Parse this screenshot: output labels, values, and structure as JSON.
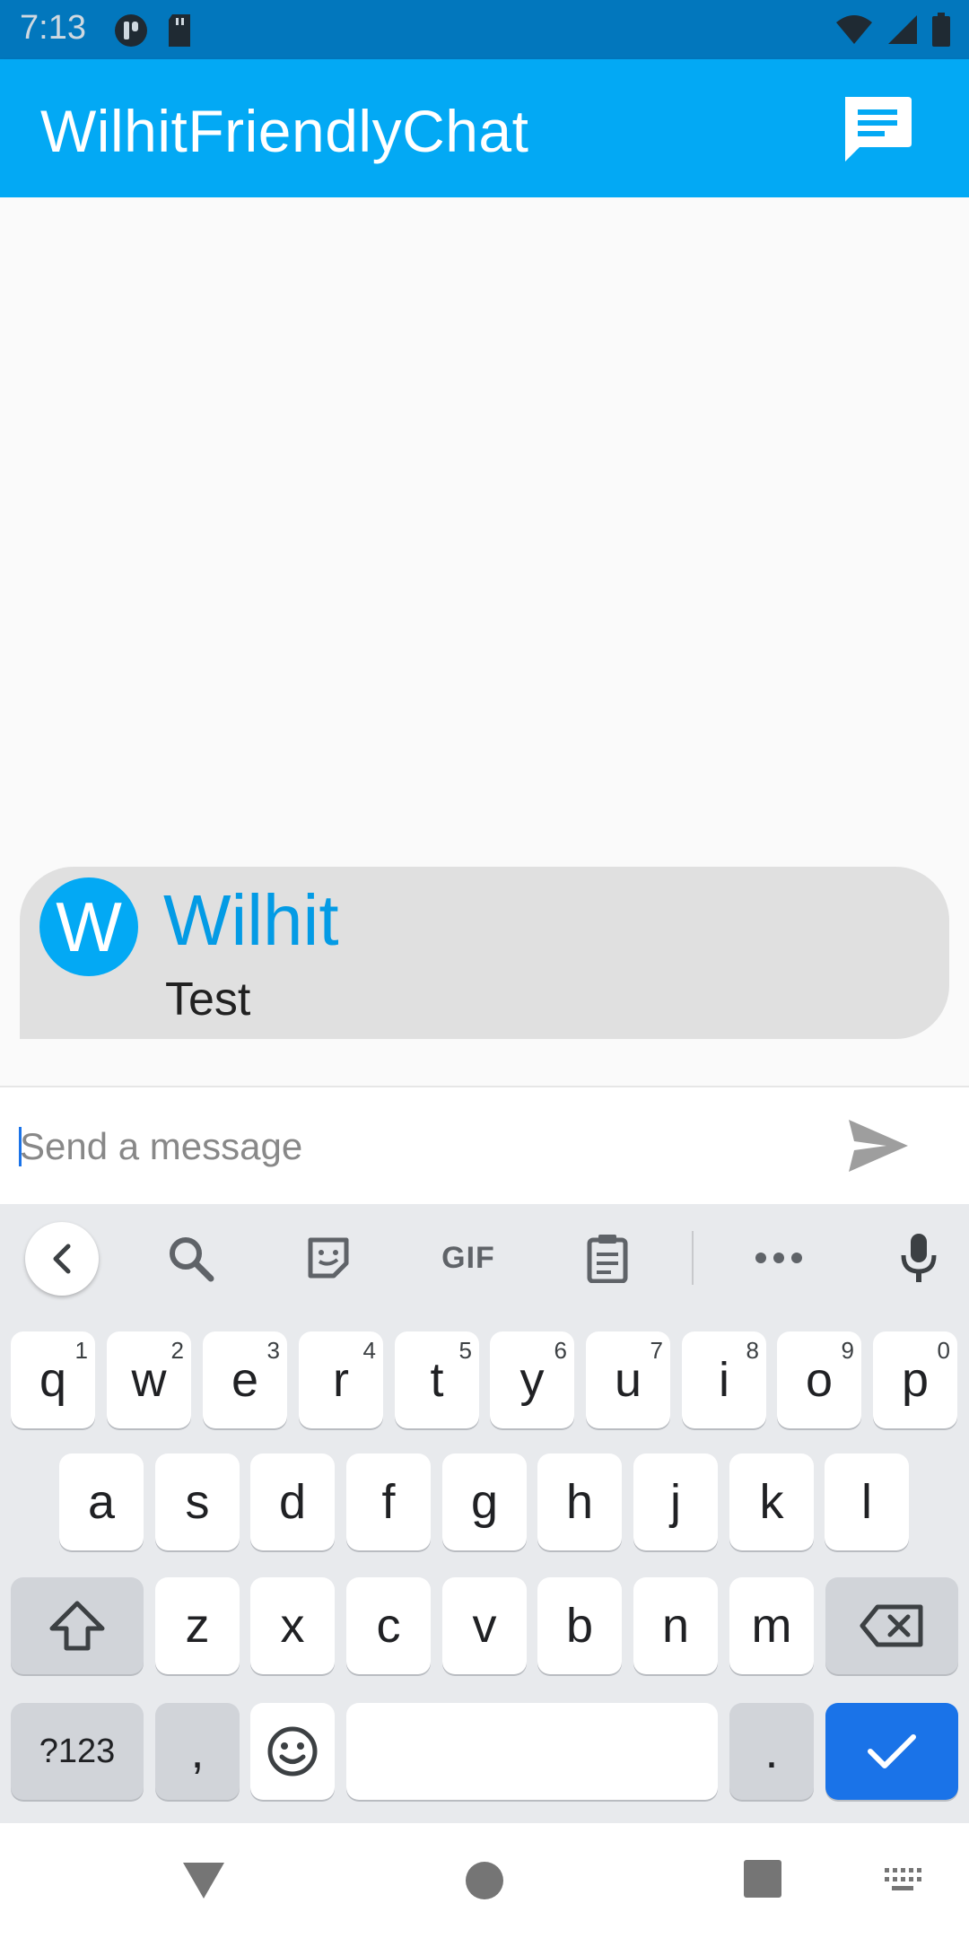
{
  "status_bar": {
    "time": "7:13"
  },
  "app_bar": {
    "title": "WilhitFriendlyChat"
  },
  "messages": [
    {
      "avatar_letter": "W",
      "sender": "Wilhit",
      "text": "Test"
    }
  ],
  "composer": {
    "placeholder": "Send a message"
  },
  "keyboard": {
    "toolbar": {
      "gif_label": "GIF"
    },
    "row1": [
      {
        "key": "q",
        "num": "1"
      },
      {
        "key": "w",
        "num": "2"
      },
      {
        "key": "e",
        "num": "3"
      },
      {
        "key": "r",
        "num": "4"
      },
      {
        "key": "t",
        "num": "5"
      },
      {
        "key": "y",
        "num": "6"
      },
      {
        "key": "u",
        "num": "7"
      },
      {
        "key": "i",
        "num": "8"
      },
      {
        "key": "o",
        "num": "9"
      },
      {
        "key": "p",
        "num": "0"
      }
    ],
    "row2": [
      "a",
      "s",
      "d",
      "f",
      "g",
      "h",
      "j",
      "k",
      "l"
    ],
    "row3": [
      "z",
      "x",
      "c",
      "v",
      "b",
      "n",
      "m"
    ],
    "symbols_label": "?123",
    "comma_label": ",",
    "period_label": "."
  },
  "colors": {
    "status_bar": "#0277bd",
    "app_bar": "#03a9f4",
    "accent": "#1a73e8",
    "bubble": "#e0e0e0"
  }
}
